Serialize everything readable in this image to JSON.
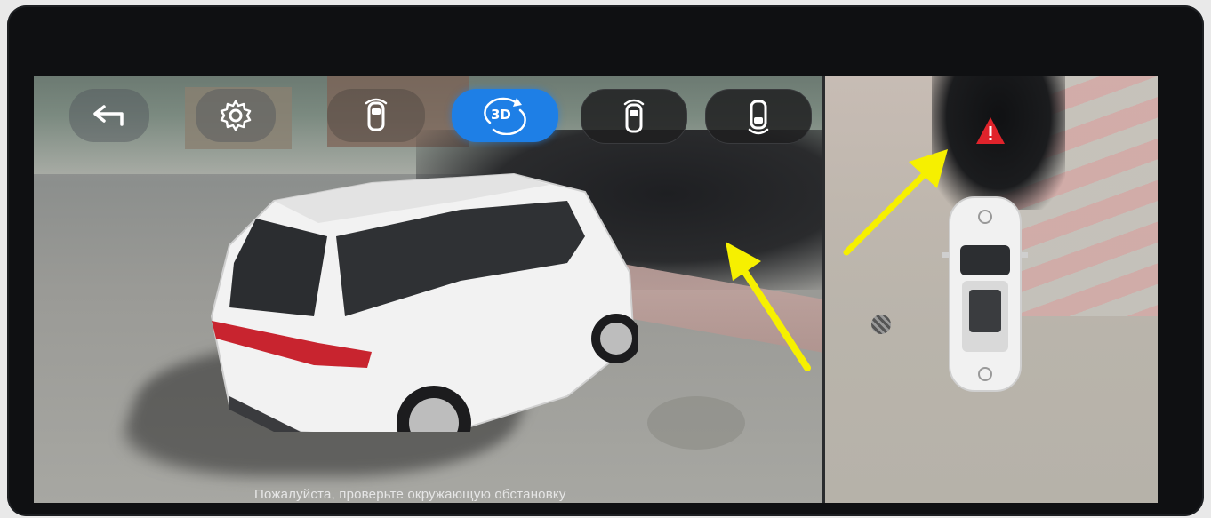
{
  "toolbar": {
    "back_icon": "back-arrow-icon",
    "settings_icon": "gear-icon",
    "view_3d_label": "3D",
    "active_view": "3d"
  },
  "notice": {
    "text": "Пожалуйста, проверьте окружающую обстановку"
  },
  "topdown": {
    "warning_icon": "warning-triangle-icon",
    "warning_color": "#e0232b"
  },
  "colors": {
    "active_button": "#1e7fe6",
    "annotation_arrow": "#f6f000"
  }
}
